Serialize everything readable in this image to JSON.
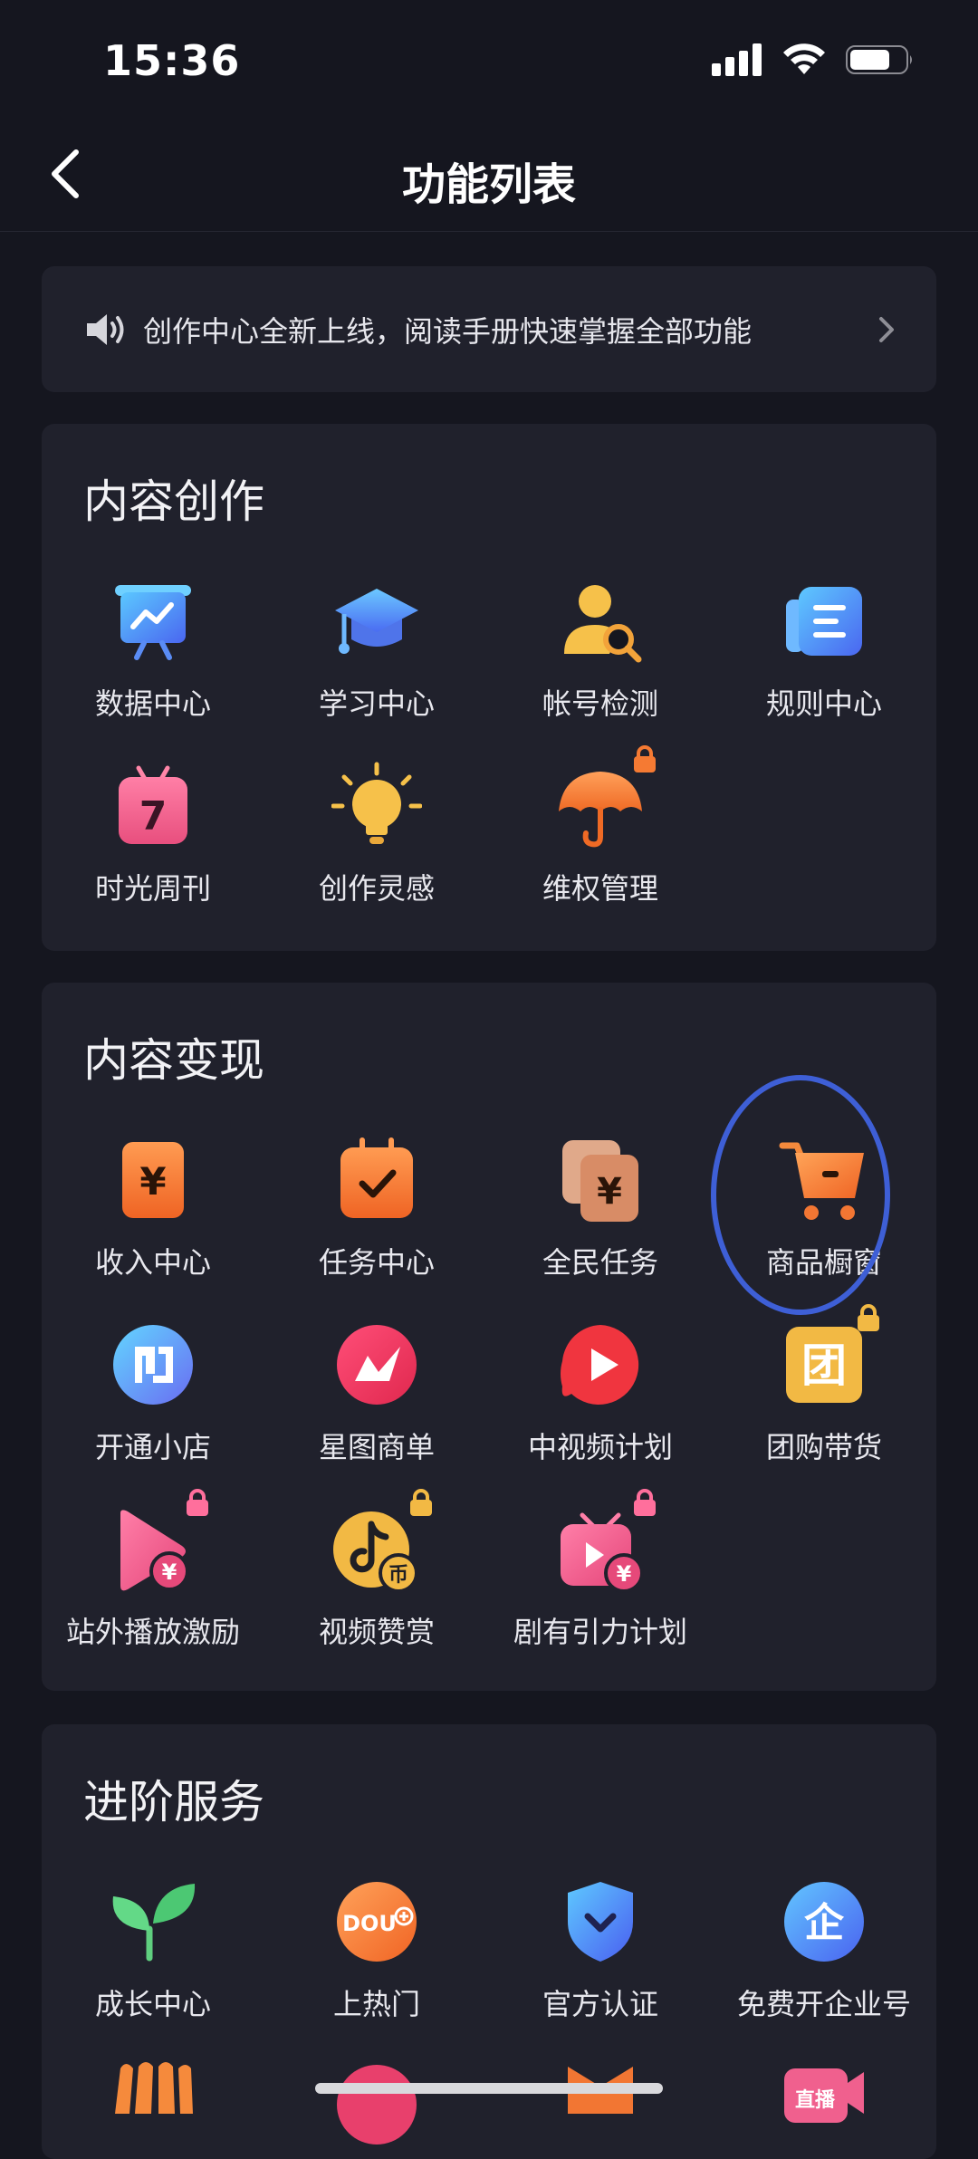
{
  "status": {
    "time": "15:36"
  },
  "nav": {
    "title": "功能列表"
  },
  "notice": {
    "text": "创作中心全新上线，阅读手册快速掌握全部功能"
  },
  "sections": [
    {
      "title": "内容创作",
      "items": [
        {
          "label": "数据中心",
          "icon": "data-center-icon"
        },
        {
          "label": "学习中心",
          "icon": "learning-center-icon"
        },
        {
          "label": "帐号检测",
          "icon": "account-check-icon"
        },
        {
          "label": "规则中心",
          "icon": "rules-center-icon"
        },
        {
          "label": "时光周刊",
          "icon": "weekly-calendar-icon"
        },
        {
          "label": "创作灵感",
          "icon": "lightbulb-icon"
        },
        {
          "label": "维权管理",
          "icon": "umbrella-icon",
          "locked": true
        }
      ]
    },
    {
      "title": "内容变现",
      "items": [
        {
          "label": "收入中心",
          "icon": "income-icon"
        },
        {
          "label": "任务中心",
          "icon": "task-center-icon"
        },
        {
          "label": "全民任务",
          "icon": "public-task-icon"
        },
        {
          "label": "商品橱窗",
          "icon": "shopping-cart-icon"
        },
        {
          "label": "开通小店",
          "icon": "open-shop-icon"
        },
        {
          "label": "星图商单",
          "icon": "star-map-icon"
        },
        {
          "label": "中视频计划",
          "icon": "video-plan-icon"
        },
        {
          "label": "团购带货",
          "icon": "group-buy-icon",
          "locked": true
        },
        {
          "label": "站外播放激励",
          "icon": "external-play-icon",
          "locked": true
        },
        {
          "label": "视频赞赏",
          "icon": "video-tip-icon",
          "locked": true
        },
        {
          "label": "剧有引力计划",
          "icon": "drama-plan-icon",
          "locked": true
        }
      ]
    },
    {
      "title": "进阶服务",
      "items": [
        {
          "label": "成长中心",
          "icon": "sprout-icon"
        },
        {
          "label": "上热门",
          "icon": "dou-plus-icon"
        },
        {
          "label": "官方认证",
          "icon": "shield-check-icon"
        },
        {
          "label": "免费开企业号",
          "icon": "enterprise-icon"
        }
      ]
    }
  ],
  "icon_glyphs": {
    "group_buy": "团",
    "enterprise": "企",
    "weekly": "7",
    "yuan": "¥",
    "coin": "币",
    "dou": "DOU",
    "live": "直播"
  },
  "colors": {
    "background": "#15161f",
    "card": "#20212c",
    "accent_orange": "#f2782f",
    "annotation": "#3e5fd6"
  }
}
